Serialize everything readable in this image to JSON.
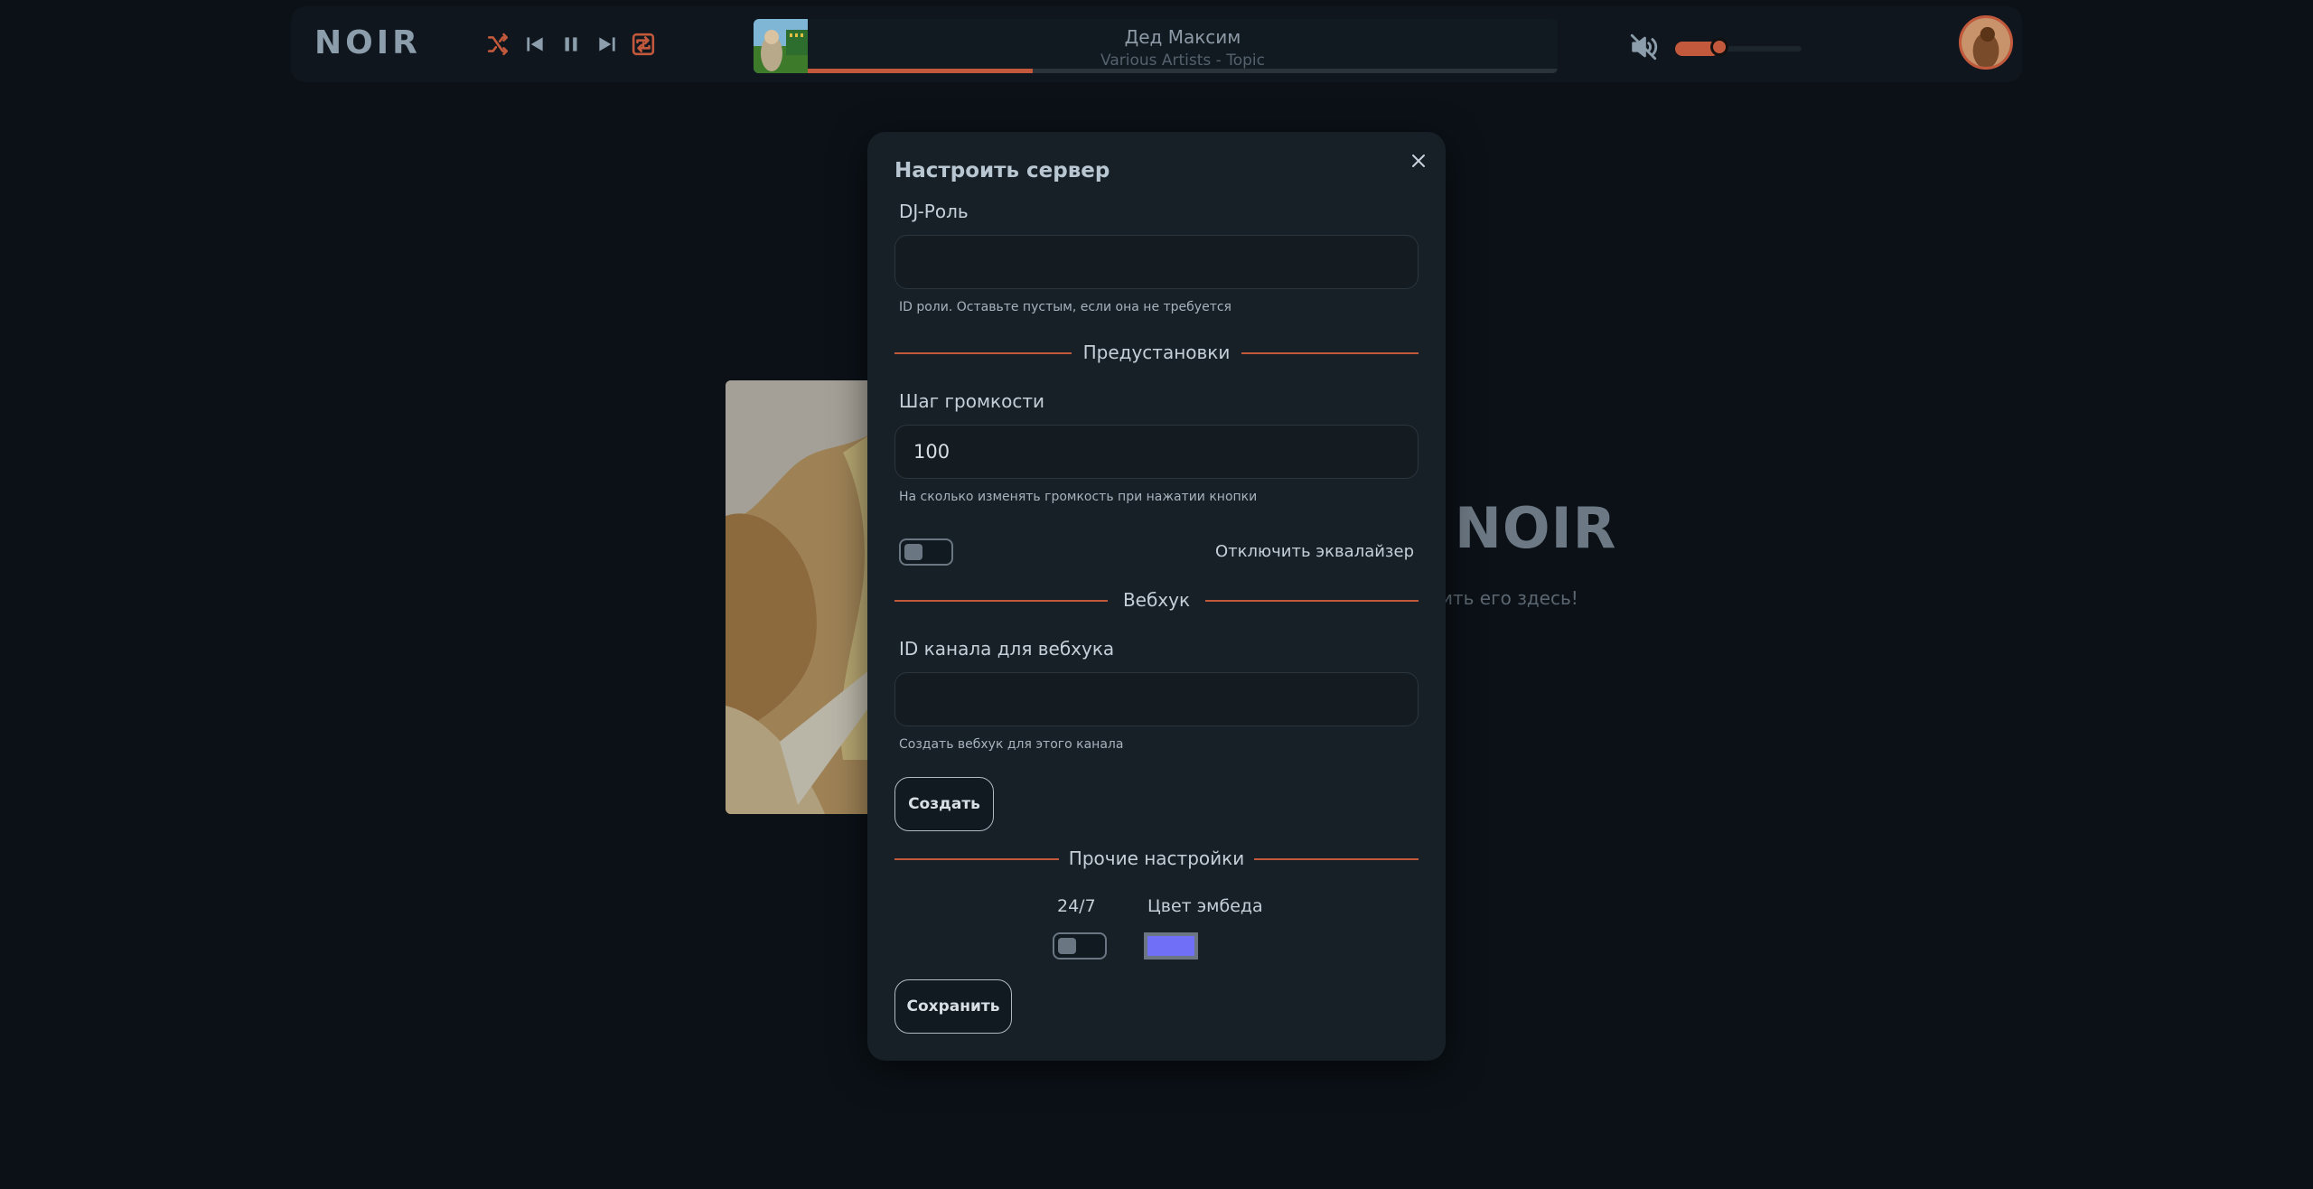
{
  "app": {
    "logo": "NOIR"
  },
  "player": {
    "controls": {
      "shuffle": "shuffle-icon",
      "prev": "skip-back-icon",
      "pause": "pause-icon",
      "next": "skip-forward-icon",
      "repeat": "repeat-one-icon"
    },
    "track": {
      "title": "Дед Максим",
      "artist": "Various Artists - Topic",
      "progress_fraction": 0.3
    },
    "volume_fraction": 0.35,
    "accent_color": "#c2593c"
  },
  "background": {
    "title": "NOIR",
    "subtitle": "ить его здесь!"
  },
  "modal": {
    "title": "Настроить сервер",
    "dj_role": {
      "label": "DJ-Роль",
      "value": "",
      "hint": "ID роли. Оставьте пустым, если она не требуется"
    },
    "presets_section": "Предустановки",
    "volume_step": {
      "label": "Шаг громкости",
      "value": "100",
      "hint": "На сколько изменять громкость при нажатии кнопки"
    },
    "equalizer_toggle": {
      "label": "Отключить эквалайзер",
      "on": false
    },
    "webhook_section": "Вебхук",
    "webhook_channel": {
      "label": "ID канала для вебхука",
      "value": "",
      "hint": "Создать вебхук для этого канала"
    },
    "create_button": "Создать",
    "other_section": "Прочие настройки",
    "always_on": {
      "label": "24/7",
      "on": false
    },
    "embed_color": {
      "label": "Цвет эмбеда",
      "value": "#6f6ff7"
    },
    "save_button": "Сохранить"
  }
}
